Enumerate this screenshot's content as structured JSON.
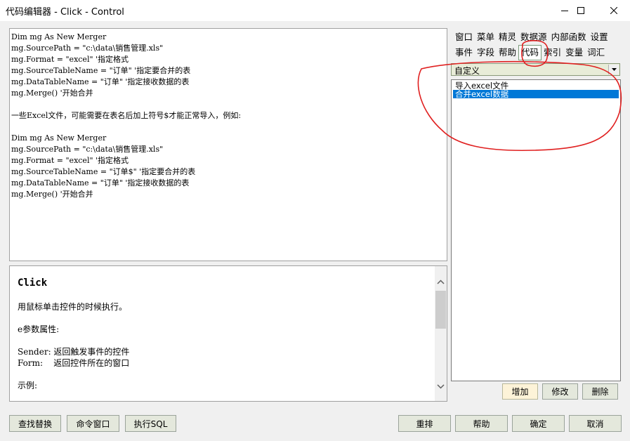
{
  "window": {
    "title": "代码编辑器 - Click - Control",
    "controls": [
      "minimize-icon",
      "maximize-icon",
      "close-icon"
    ]
  },
  "code_lines": [
    "Dim mg As New Merger",
    "mg.SourcePath = \"c:\\data\\销售管理.xls\"",
    "mg.Format = \"excel\" '指定格式",
    "mg.SourceTableName = \"订单\" '指定要合并的表",
    "mg.DataTableName = \"订单\" '指定接收数据的表",
    "mg.Merge() '开始合并",
    "",
    "一些Excel文件，可能需要在表名后加上符号$才能正常导入，例如:",
    "",
    "Dim mg As New Merger",
    "mg.SourcePath = \"c:\\data\\销售管理.xls\"",
    "mg.Format = \"excel\" '指定格式",
    "mg.SourceTableName = \"订单$\" '指定要合并的表",
    "mg.DataTableName = \"订单\" '指定接收数据的表",
    "mg.Merge() '开始合并"
  ],
  "help": {
    "title": "Click",
    "lines": [
      "",
      "用鼠标单击控件的时候执行。",
      "",
      "e参数属性:",
      "",
      "Sender: 返回触发事件的控件",
      "Form:    返回控件所在的窗口",
      "",
      "示例:"
    ]
  },
  "tabs": {
    "row1": [
      "窗口",
      "菜单",
      "精灵",
      "数据源",
      "内部函数",
      "设置"
    ],
    "row2": [
      "事件",
      "字段",
      "帮助",
      "代码",
      "索引",
      "变量",
      "词汇"
    ],
    "active": "代码"
  },
  "combo": {
    "value": "自定义"
  },
  "list": {
    "items": [
      {
        "label": "导入excel文件",
        "selected": false
      },
      {
        "label": "合并excel数据",
        "selected": true
      }
    ]
  },
  "side_buttons": {
    "add": "增加",
    "edit": "修改",
    "delete": "删除"
  },
  "bottom_buttons": {
    "find_replace": "查找替换",
    "command_window": "命令窗口",
    "exec_sql": "执行SQL",
    "rearrange": "重排",
    "help": "帮助",
    "ok": "确定",
    "cancel": "取消"
  },
  "colors": {
    "selection": "#0078d7",
    "annotation": "#e02020",
    "button_face": "#e4e8dc",
    "combo_face": "#e8ecd8"
  }
}
